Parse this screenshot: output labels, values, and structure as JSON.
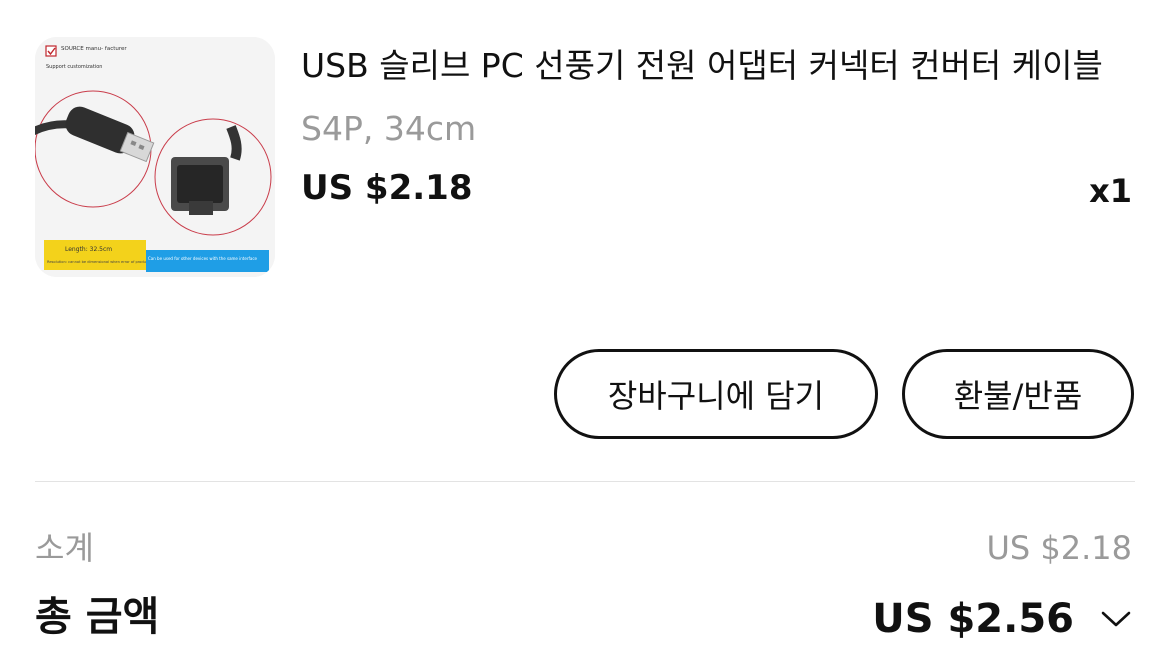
{
  "product": {
    "title": "USB 슬리브 PC 선풍기 전원 어댑터 커넥터 컨버터 케이블",
    "variant": "S4P, 34cm",
    "price": "US $2.18",
    "quantity": "x1",
    "image": {
      "brand_text": "SOURCE manu-\nfacturer",
      "subtitle_text": "Support customization",
      "length_label": "Length: 32.5cm",
      "note_text": "Resolution: cannot be dimensional when error of products",
      "compat_text": "Can be used for other devices with the same interface"
    }
  },
  "actions": {
    "add_to_cart": "장바구니에 담기",
    "refund": "환불/반품"
  },
  "summary": {
    "subtotal_label": "소계",
    "subtotal_value": "US $2.18",
    "total_label": "총 금액",
    "total_value": "US $2.56"
  },
  "colors": {
    "text": "#111111",
    "muted": "#9a9a9a",
    "divider": "#e3e3e3",
    "image_yellow": "#f3d21b",
    "image_blue": "#1f9ee6"
  },
  "icons": {
    "expand": "chevron-down-icon"
  }
}
